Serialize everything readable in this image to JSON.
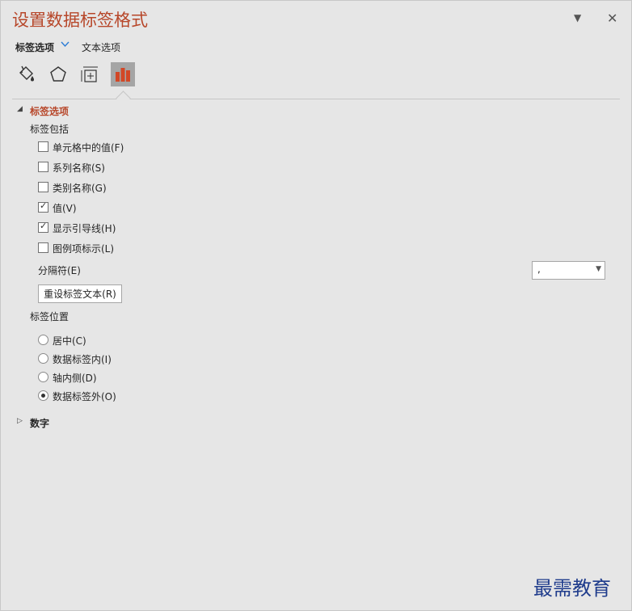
{
  "panel": {
    "title": "设置数据标签格式"
  },
  "tabs": {
    "label_options": "标签选项",
    "text_options": "文本选项"
  },
  "icons": [
    "fill-line-icon",
    "effects-icon",
    "size-properties-icon",
    "label-options-icon"
  ],
  "section": {
    "label_options": "标签选项",
    "contains_label": "标签包括",
    "checkboxes": [
      {
        "label": "单元格中的值(F)",
        "checked": false
      },
      {
        "label": "系列名称(S)",
        "checked": false
      },
      {
        "label": "类别名称(G)",
        "checked": false
      },
      {
        "label": "值(V)",
        "checked": true
      },
      {
        "label": "显示引导线(H)",
        "checked": true
      },
      {
        "label": "图例项标示(L)",
        "checked": false
      }
    ],
    "separator_label": "分隔符(E)",
    "separator_value": ",",
    "reset_button": "重设标签文本(R)",
    "position_label": "标签位置",
    "radios": [
      {
        "label": "居中(C)",
        "selected": false
      },
      {
        "label": "数据标签内(I)",
        "selected": false
      },
      {
        "label": "轴内侧(D)",
        "selected": false
      },
      {
        "label": "数据标签外(O)",
        "selected": true
      }
    ],
    "number_section": "数字"
  },
  "watermark": "最需教育",
  "colors": {
    "accent": "#b7472a",
    "background": "#e6e6e6",
    "chart_icon": "#d24726"
  }
}
